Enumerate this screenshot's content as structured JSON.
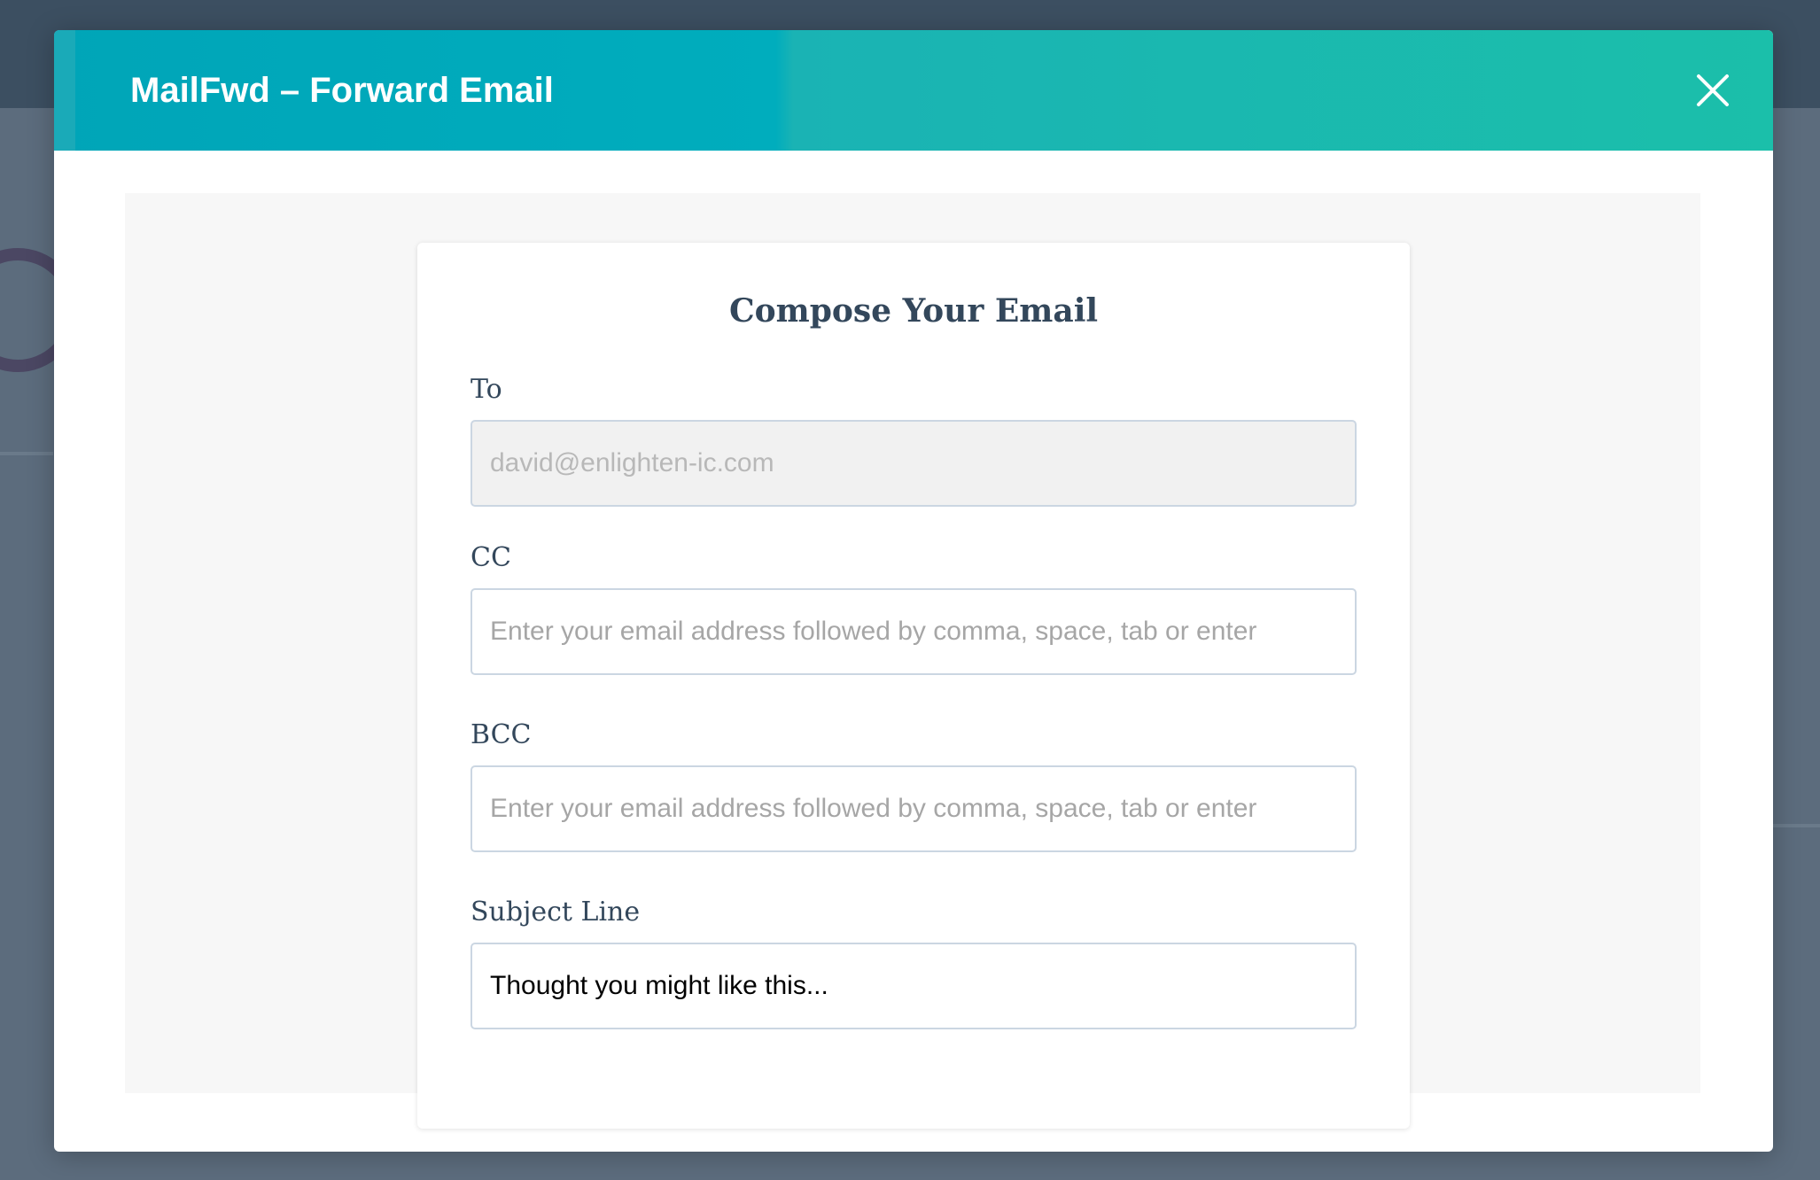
{
  "modal": {
    "title": "MailFwd – Forward Email",
    "close_icon": "close-icon"
  },
  "compose": {
    "heading": "Compose Your Email",
    "to": {
      "label": "To",
      "value": "david@enlighten-ic.com"
    },
    "cc": {
      "label": "CC",
      "placeholder": "Enter your email address followed by comma, space, tab or enter"
    },
    "bcc": {
      "label": "BCC",
      "placeholder": "Enter your email address followed by comma, space, tab or enter"
    },
    "subject": {
      "label": "Subject Line",
      "value": "Thought you might like this..."
    }
  },
  "colors": {
    "header_start": "#00a5b8",
    "header_end": "#1bbfaa",
    "text_dark": "#33475b",
    "input_border": "#cbd6e2"
  }
}
